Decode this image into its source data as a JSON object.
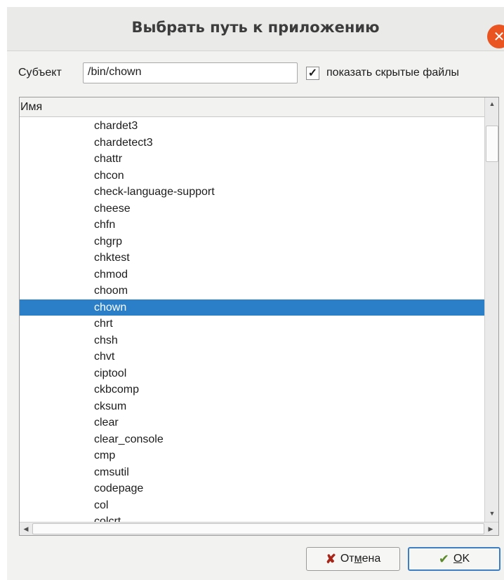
{
  "window": {
    "title": "Выбрать путь к приложению",
    "close_glyph": "✕"
  },
  "subject": {
    "label": "Субъект",
    "value": "/bin/chown"
  },
  "show_hidden": {
    "checked": true,
    "glyph": "✓",
    "label": "показать скрытые файлы"
  },
  "list": {
    "column_header": "Имя",
    "selected_index": 11,
    "items": [
      "chardet3",
      "chardetect3",
      "chattr",
      "chcon",
      "check-language-support",
      "cheese",
      "chfn",
      "chgrp",
      "chktest",
      "chmod",
      "choom",
      "chown",
      "chrt",
      "chsh",
      "chvt",
      "ciptool",
      "ckbcomp",
      "cksum",
      "clear",
      "clear_console",
      "cmp",
      "cmsutil",
      "codepage",
      "col",
      "colcrt"
    ],
    "scroll_up_glyph": "▲",
    "scroll_down_glyph": "▼",
    "scroll_left_glyph": "◀",
    "scroll_right_glyph": "▶"
  },
  "buttons": {
    "cancel": {
      "pre": "От",
      "mnemonic": "м",
      "post": "ена",
      "icon": "cross-icon"
    },
    "ok": {
      "pre": "",
      "mnemonic": "О",
      "post": "K",
      "icon": "checkmark-icon"
    }
  },
  "colors": {
    "selection": "#2a7fc8",
    "close": "#e95420",
    "ok_border": "#3d7fc2"
  }
}
